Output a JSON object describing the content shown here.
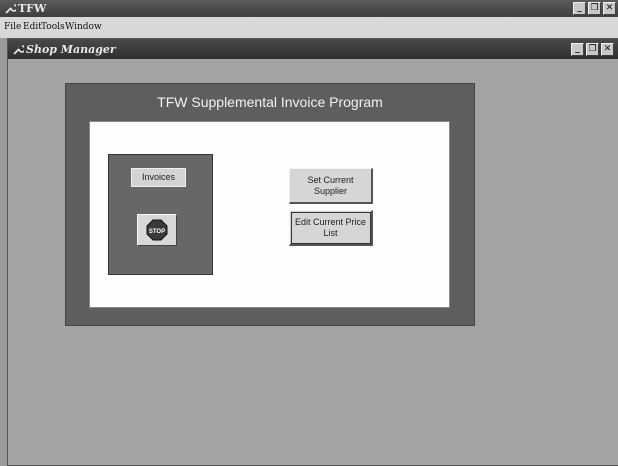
{
  "app": {
    "title": "TFW",
    "menu": [
      "File",
      "Edit",
      "Tools",
      "Window"
    ],
    "window_buttons": [
      "minimize",
      "restore",
      "close"
    ]
  },
  "child_window": {
    "title": "Shop Manager"
  },
  "form": {
    "title": "TFW Supplemental Invoice Program",
    "invoices_label": "Invoices",
    "stop_button_text": "STOP",
    "set_supplier_label": "Set Current Supplier",
    "edit_price_list_label": "Edit Current Price List"
  },
  "icons": {
    "app_icon": "wrench-icon",
    "stop_icon": "stop-sign-icon"
  },
  "colors": {
    "background": "#9a9a9a",
    "titlebar": "#3e3e3e",
    "form_panel": "#5e5e5e",
    "form_inner": "#fefefe",
    "stop_sign": "#3a3a3a"
  }
}
